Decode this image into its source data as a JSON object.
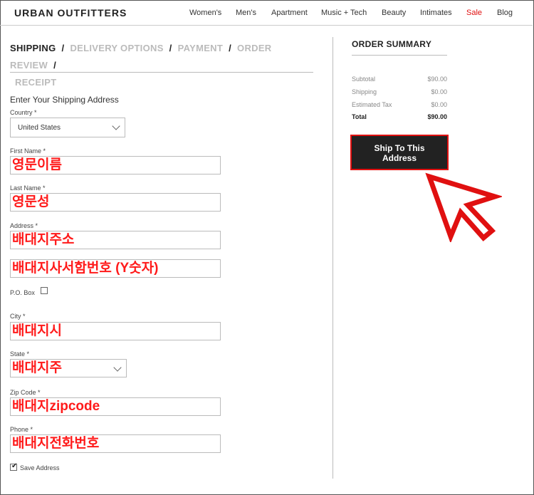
{
  "header": {
    "logo": "URBAN OUTFITTERS",
    "nav": [
      "Women's",
      "Men's",
      "Apartment",
      "Music + Tech",
      "Beauty",
      "Intimates",
      "Sale",
      "Blog"
    ],
    "sale_color": "#e01010"
  },
  "steps": {
    "shipping": "SHIPPING",
    "delivery": "DELIVERY OPTIONS",
    "payment": "PAYMENT",
    "review": "ORDER REVIEW",
    "receipt": "RECEIPT",
    "separator": "/"
  },
  "form": {
    "title": "Enter Your Shipping Address",
    "country_label": "Country *",
    "country_value": "United States",
    "first_name_label": "First Name *",
    "first_name_value": "영문이름",
    "last_name_label": "Last Name *",
    "last_name_value": "영문성",
    "address_label": "Address *",
    "address_value": "배대지주소",
    "address2_value": "배대지사서함번호 (Y숫자)",
    "po_box_label": "P.O. Box",
    "city_label": "City *",
    "city_value": "배대지시",
    "state_label": "State *",
    "state_value": "배대지주",
    "zip_label": "Zip Code *",
    "zip_value": "배대지zipcode",
    "phone_label": "Phone *",
    "phone_value": "배대지전화번호",
    "save_address_label": "Save Address",
    "save_address_checked": true
  },
  "summary": {
    "title": "ORDER SUMMARY",
    "subtotal_label": "Subtotal",
    "subtotal_value": "$90.00",
    "shipping_label": "Shipping",
    "shipping_value": "$0.00",
    "tax_label": "Estimated Tax",
    "tax_value": "$0.00",
    "total_label": "Total",
    "total_value": "$90.00",
    "button_label": "Ship To This Address"
  },
  "annotation_color": "#e01010"
}
